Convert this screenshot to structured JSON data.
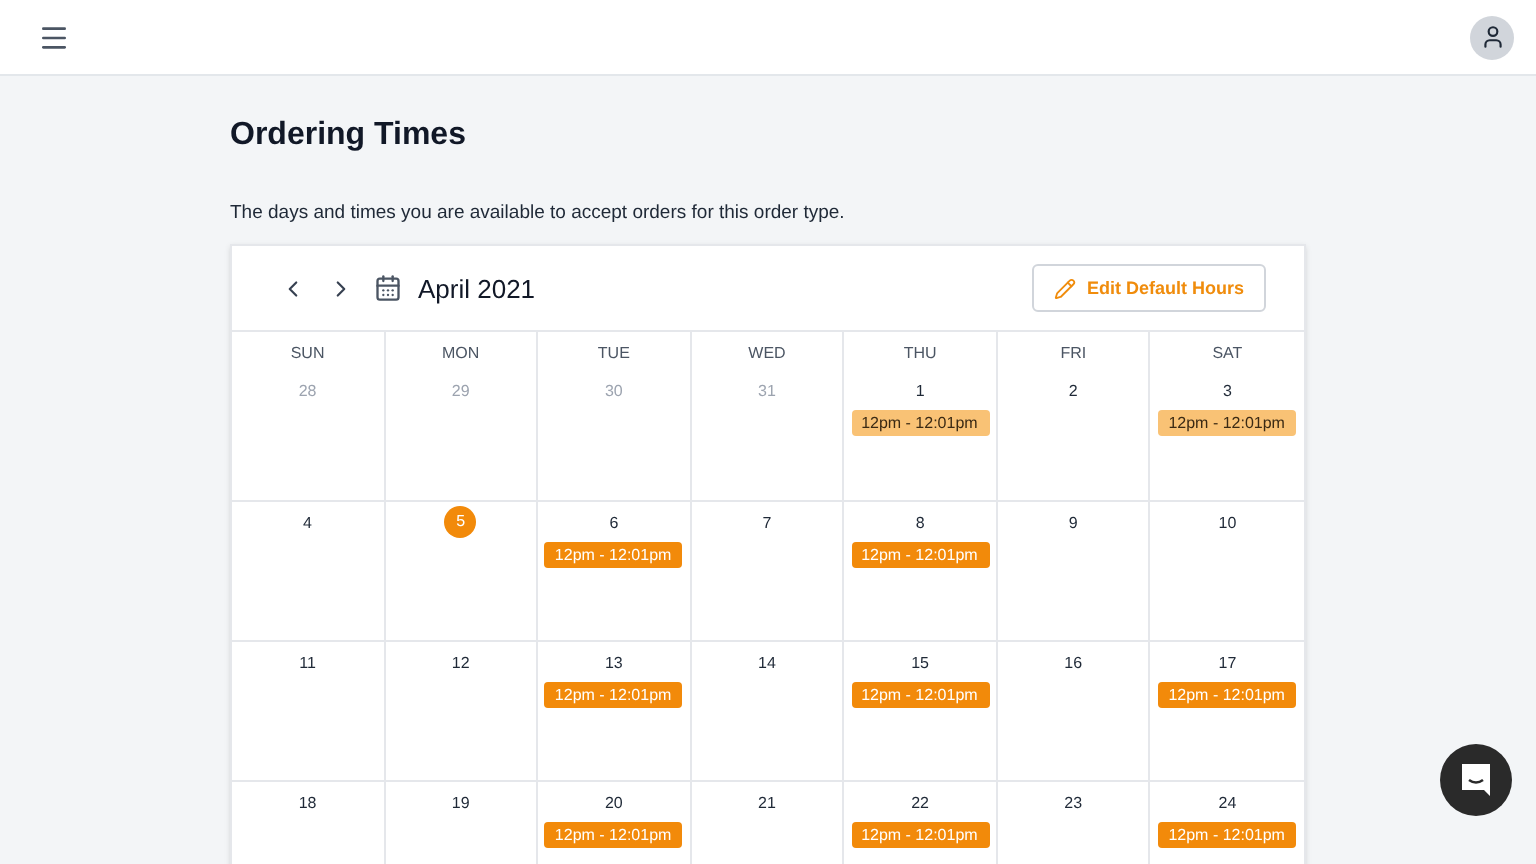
{
  "page": {
    "title": "Ordering Times",
    "description": "The days and times you are available to accept orders for this order type."
  },
  "calendar": {
    "month": "April 2021",
    "edit_button": "Edit Default Hours",
    "weekdays": [
      "SUN",
      "MON",
      "TUE",
      "WED",
      "THU",
      "FRI",
      "SAT"
    ],
    "weeks": [
      [
        {
          "day": "28",
          "muted": true,
          "today": false
        },
        {
          "day": "29",
          "muted": true,
          "today": false
        },
        {
          "day": "30",
          "muted": true,
          "today": false
        },
        {
          "day": "31",
          "muted": true,
          "today": false
        },
        {
          "day": "1",
          "muted": false,
          "today": false,
          "event": {
            "label": "12pm - 12:01pm",
            "past": true
          }
        },
        {
          "day": "2",
          "muted": false,
          "today": false
        },
        {
          "day": "3",
          "muted": false,
          "today": false,
          "event": {
            "label": "12pm - 12:01pm",
            "past": true
          }
        }
      ],
      [
        {
          "day": "4",
          "muted": false,
          "today": false
        },
        {
          "day": "5",
          "muted": false,
          "today": true
        },
        {
          "day": "6",
          "muted": false,
          "today": false,
          "event": {
            "label": "12pm - 12:01pm",
            "past": false
          }
        },
        {
          "day": "7",
          "muted": false,
          "today": false
        },
        {
          "day": "8",
          "muted": false,
          "today": false,
          "event": {
            "label": "12pm - 12:01pm",
            "past": false
          }
        },
        {
          "day": "9",
          "muted": false,
          "today": false
        },
        {
          "day": "10",
          "muted": false,
          "today": false
        }
      ],
      [
        {
          "day": "11",
          "muted": false,
          "today": false
        },
        {
          "day": "12",
          "muted": false,
          "today": false
        },
        {
          "day": "13",
          "muted": false,
          "today": false,
          "event": {
            "label": "12pm - 12:01pm",
            "past": false
          }
        },
        {
          "day": "14",
          "muted": false,
          "today": false
        },
        {
          "day": "15",
          "muted": false,
          "today": false,
          "event": {
            "label": "12pm - 12:01pm",
            "past": false
          }
        },
        {
          "day": "16",
          "muted": false,
          "today": false
        },
        {
          "day": "17",
          "muted": false,
          "today": false,
          "event": {
            "label": "12pm - 12:01pm",
            "past": false
          }
        }
      ],
      [
        {
          "day": "18",
          "muted": false,
          "today": false
        },
        {
          "day": "19",
          "muted": false,
          "today": false
        },
        {
          "day": "20",
          "muted": false,
          "today": false,
          "event": {
            "label": "12pm - 12:01pm",
            "past": false
          }
        },
        {
          "day": "21",
          "muted": false,
          "today": false
        },
        {
          "day": "22",
          "muted": false,
          "today": false,
          "event": {
            "label": "12pm - 12:01pm",
            "past": false
          }
        },
        {
          "day": "23",
          "muted": false,
          "today": false
        },
        {
          "day": "24",
          "muted": false,
          "today": false,
          "event": {
            "label": "12pm - 12:01pm",
            "past": false
          }
        }
      ]
    ]
  }
}
